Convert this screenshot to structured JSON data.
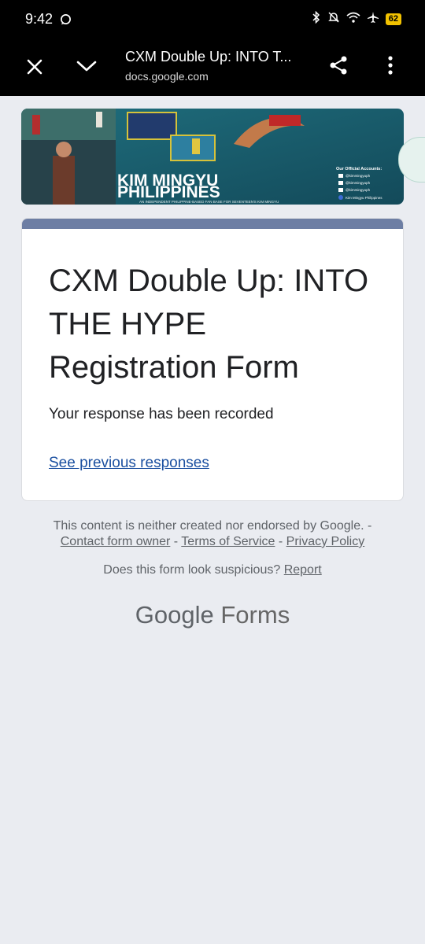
{
  "status": {
    "time": "9:42",
    "battery": "62",
    "icons": [
      "message-icon",
      "bluetooth-icon",
      "bell-off-icon",
      "wifi-icon",
      "airplane-icon",
      "battery-icon"
    ]
  },
  "appbar": {
    "title": "CXM Double Up: INTO T...",
    "url": "docs.google.com",
    "icons": [
      "close-icon",
      "chevron-down-icon",
      "share-icon",
      "more-vert-icon"
    ]
  },
  "banner": {
    "brand_line1": "KIM MINGYU",
    "brand_line2": "PHILIPPINES",
    "tagline": "AN INDEPENDENT PHILIPPINE-BASED FAN BASE FOR SEVENTEEN'S KIM MINGYU",
    "accounts_heading": "Our Official Accounts:",
    "accounts": [
      "@kimmingyuph",
      "@kimmingyuph",
      "@kimmingyuph",
      "Kim Mingyu Philippines"
    ]
  },
  "form": {
    "title": "CXM Double Up: INTO THE HYPE Registration Form",
    "response_message": "Your response has been recorded",
    "previous_link": "See previous responses"
  },
  "footer": {
    "disclaimer": "This content is neither created nor endorsed by Google. -",
    "contact_owner": "Contact form owner",
    "sep1": " - ",
    "terms": "Terms of Service",
    "sep2": " - ",
    "privacy": "Privacy Policy",
    "suspicious": "Does this form look suspicious?",
    "report": "Report",
    "brand_google": "Google",
    "brand_forms": "Forms"
  },
  "colors": {
    "accent": "#6d7ea4",
    "link": "#1a4fa0",
    "background": "#eaecf1"
  }
}
